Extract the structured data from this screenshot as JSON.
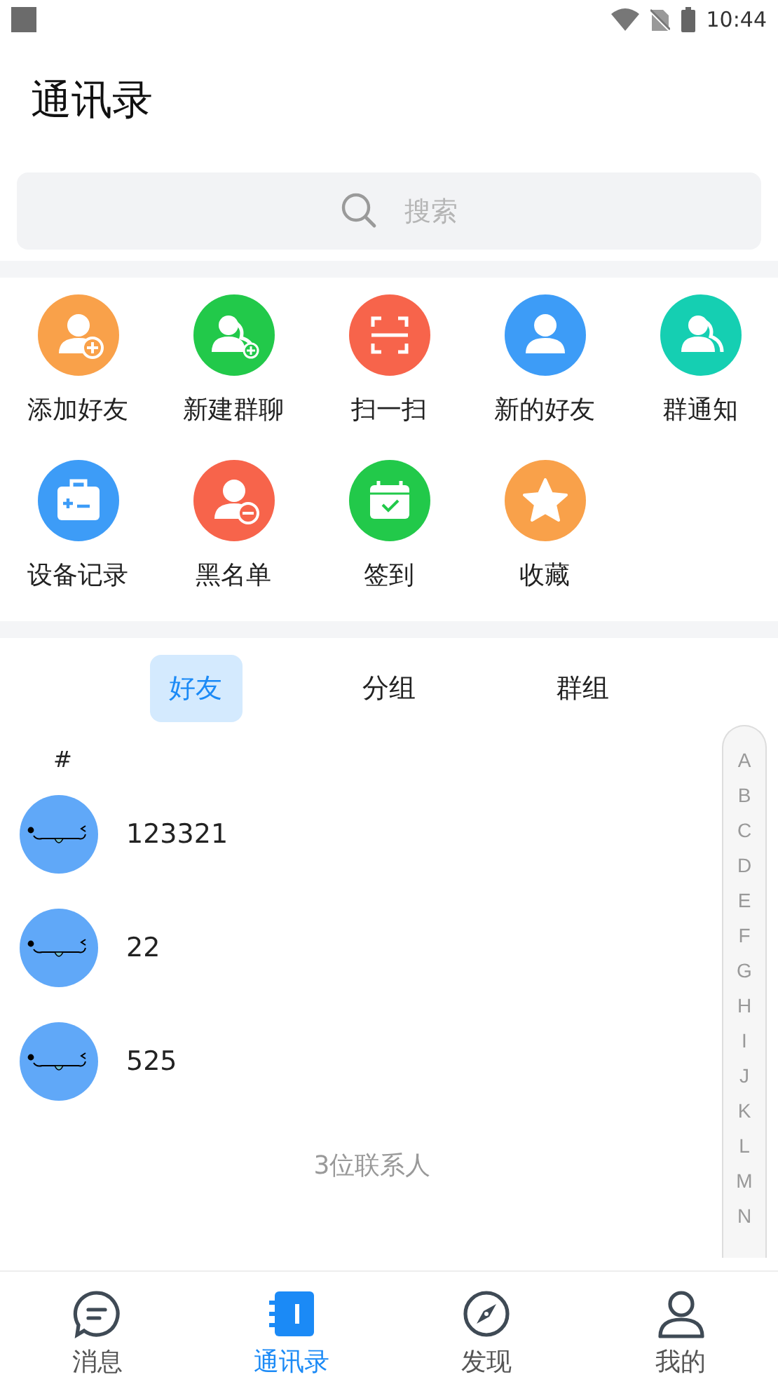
{
  "status_bar": {
    "time": "10:44"
  },
  "title": "通讯录",
  "search": {
    "placeholder": "搜索"
  },
  "shortcuts": [
    {
      "label": "添加好友"
    },
    {
      "label": "新建群聊"
    },
    {
      "label": "扫一扫"
    },
    {
      "label": "新的好友"
    },
    {
      "label": "群通知"
    },
    {
      "label": "设备记录"
    },
    {
      "label": "黑名单"
    },
    {
      "label": "签到"
    },
    {
      "label": "收藏"
    }
  ],
  "tabs": [
    {
      "label": "好友",
      "selected": true
    },
    {
      "label": "分组",
      "selected": false
    },
    {
      "label": "群组",
      "selected": false
    }
  ],
  "section_header": "#",
  "contacts": [
    {
      "name": "123321"
    },
    {
      "name": "22"
    },
    {
      "name": "525"
    }
  ],
  "contact_count": "3位联系人",
  "index_letters": [
    "A",
    "B",
    "C",
    "D",
    "E",
    "F",
    "G",
    "H",
    "I",
    "J",
    "K",
    "L",
    "M",
    "N"
  ],
  "bottom_nav": [
    {
      "label": "消息",
      "selected": false
    },
    {
      "label": "通讯录",
      "selected": true
    },
    {
      "label": "发现",
      "selected": false
    },
    {
      "label": "我的",
      "selected": false
    }
  ]
}
